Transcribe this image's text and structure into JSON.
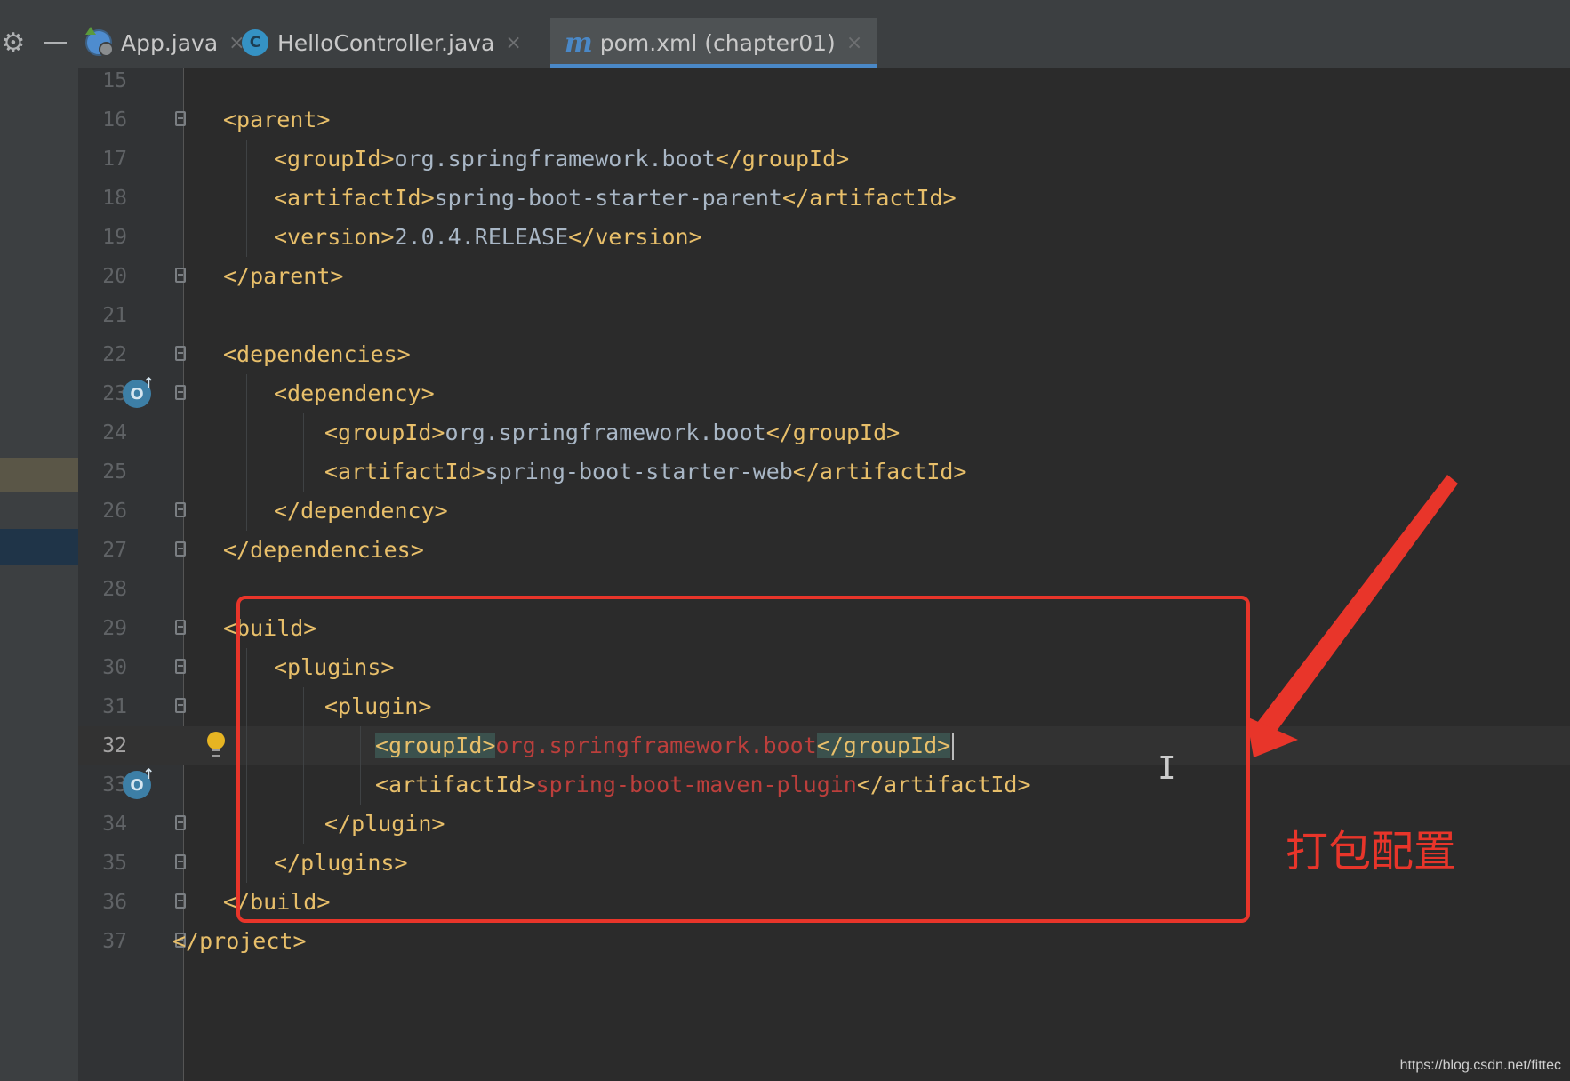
{
  "tabs": [
    {
      "label": "App.java",
      "icon": "java-app-icon",
      "active": false
    },
    {
      "label": "HelloController.java",
      "icon": "java-class-icon",
      "active": false
    },
    {
      "label": "pom.xml (chapter01)",
      "icon": "maven-icon",
      "active": true
    }
  ],
  "tab_icons": {
    "class_letter": "C",
    "maven_letter": "m",
    "close": "×"
  },
  "toolbar": {
    "gear": "⚙"
  },
  "gutter_icon_letter": "O",
  "lines": [
    {
      "n": "15",
      "code": [],
      "fold": false
    },
    {
      "n": "16",
      "code": [
        [
          "tag",
          "<parent>"
        ]
      ],
      "fold": true
    },
    {
      "n": "17",
      "code": [
        [
          "tag",
          "<groupId>"
        ],
        [
          "txt",
          "org.springframework.boot"
        ],
        [
          "tag",
          "</groupId>"
        ]
      ],
      "fold": false
    },
    {
      "n": "18",
      "code": [
        [
          "tag",
          "<artifactId>"
        ],
        [
          "txt",
          "spring-boot-starter-parent"
        ],
        [
          "tag",
          "</artifactId>"
        ]
      ],
      "fold": false
    },
    {
      "n": "19",
      "code": [
        [
          "tag",
          "<version>"
        ],
        [
          "txt",
          "2.0.4.RELEASE"
        ],
        [
          "tag",
          "</version>"
        ]
      ],
      "fold": false
    },
    {
      "n": "20",
      "code": [
        [
          "tag",
          "</parent>"
        ]
      ],
      "fold": true
    },
    {
      "n": "21",
      "code": [],
      "fold": false
    },
    {
      "n": "22",
      "code": [
        [
          "tag",
          "<dependencies>"
        ]
      ],
      "fold": true
    },
    {
      "n": "23",
      "code": [
        [
          "tag",
          "<dependency>"
        ]
      ],
      "fold": true,
      "gicon": true
    },
    {
      "n": "24",
      "code": [
        [
          "tag",
          "<groupId>"
        ],
        [
          "txt",
          "org.springframework.boot"
        ],
        [
          "tag",
          "</groupId>"
        ]
      ],
      "fold": false
    },
    {
      "n": "25",
      "code": [
        [
          "tag",
          "<artifactId>"
        ],
        [
          "txt",
          "spring-boot-starter-web"
        ],
        [
          "tag",
          "</artifactId>"
        ]
      ],
      "fold": false
    },
    {
      "n": "26",
      "code": [
        [
          "tag",
          "</dependency>"
        ]
      ],
      "fold": true
    },
    {
      "n": "27",
      "code": [
        [
          "tag",
          "</dependencies>"
        ]
      ],
      "fold": true
    },
    {
      "n": "28",
      "code": [],
      "fold": false
    },
    {
      "n": "29",
      "code": [
        [
          "tag",
          "<build>"
        ]
      ],
      "fold": true
    },
    {
      "n": "30",
      "code": [
        [
          "tag",
          "<plugins>"
        ]
      ],
      "fold": true
    },
    {
      "n": "31",
      "code": [
        [
          "tag",
          "<plugin>"
        ]
      ],
      "fold": true
    },
    {
      "n": "32",
      "code": [
        [
          "tag hl",
          "<groupId>"
        ],
        [
          "red",
          "org.springframework.boot"
        ],
        [
          "tag hl",
          "</groupId>"
        ]
      ],
      "fold": false,
      "current": true,
      "bulb": true,
      "caret": true
    },
    {
      "n": "33",
      "code": [
        [
          "tag",
          "<artifactId>"
        ],
        [
          "red",
          "spring-boot-maven-plugin"
        ],
        [
          "tag",
          "</artifactId>"
        ]
      ],
      "fold": false,
      "gicon": true
    },
    {
      "n": "34",
      "code": [
        [
          "tag",
          "</plugin>"
        ]
      ],
      "fold": true
    },
    {
      "n": "35",
      "code": [
        [
          "tag",
          "</plugins>"
        ]
      ],
      "fold": true
    },
    {
      "n": "36",
      "code": [
        [
          "tag",
          "</build>"
        ]
      ],
      "fold": true
    },
    {
      "n": "37",
      "code": [
        [
          "tag",
          "</project>"
        ]
      ],
      "fold": true
    }
  ],
  "annotation": {
    "label": "打包配置",
    "color": "#e8352a"
  },
  "watermark": "https://blog.csdn.net/fittec",
  "colors": {
    "tag": "#e8bf6a",
    "text": "#a9b7c6",
    "unresolved": "#bc3f3c",
    "background": "#2b2b2b",
    "accent": "#4a88c7"
  }
}
